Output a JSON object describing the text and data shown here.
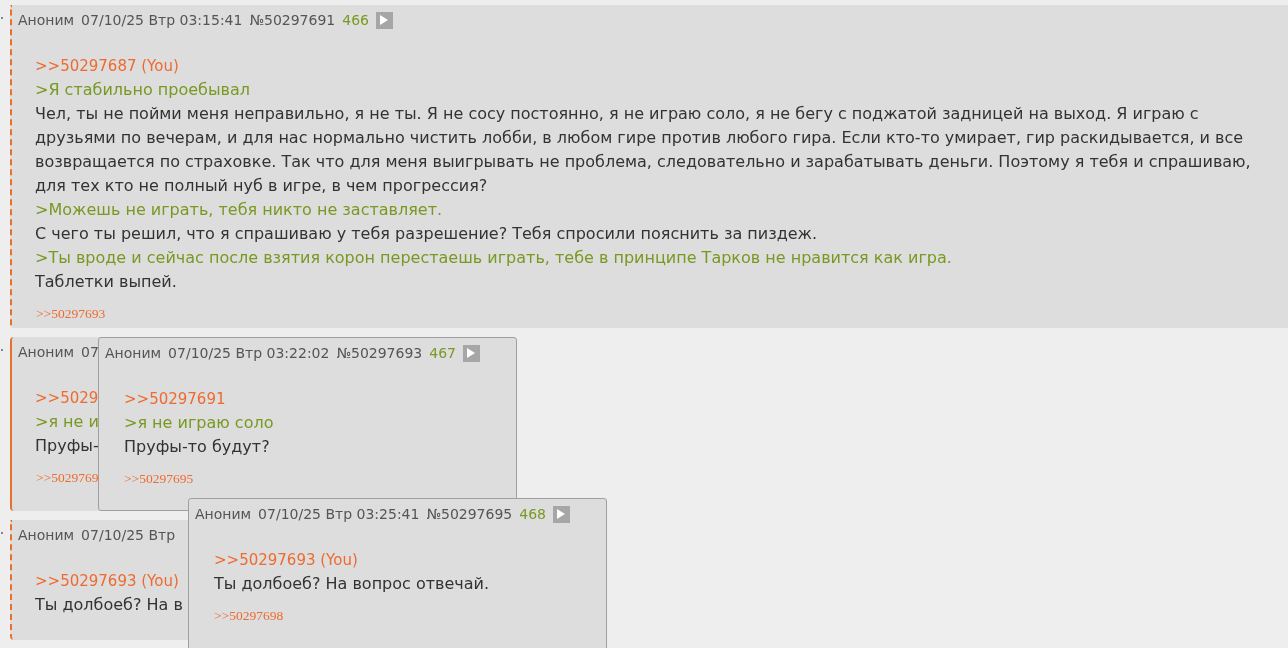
{
  "posts": [
    {
      "kind": "dashed",
      "author": "Аноним",
      "date": "07/10/25 Втр 03:15:41",
      "number": "№50297691",
      "index": "466",
      "play_button": true,
      "lines": [
        {
          "kind": "link",
          "text": ">>50297687 (You)"
        },
        {
          "kind": "quote",
          "text": ">Я стабильно проебывал"
        },
        {
          "kind": "text",
          "text": "Чел, ты не пойми меня неправильно, я не ты. Я не сосу постоянно, я не играю соло, я не бегу с поджатой задницей на выход. Я играю с друзьями по вечерам, и для нас нормально чистить лобби, в любом гире против любого гира. Если кто-то умирает, гир раскидывается, и все возвращается по страховке. Так что для меня выигрывать не проблема, следовательно и зарабатывать деньги. Поэтому я тебя и спрашиваю, для тех кто не полный нуб в игре, в чем прогрессия?"
        },
        {
          "kind": "quote",
          "text": ">Можешь не играть, тебя никто не заставляет."
        },
        {
          "kind": "text",
          "text": "С чего ты решил, что я спрашиваю у тебя разрешение? Тебя спросили пояснить за пиздеж."
        },
        {
          "kind": "quote",
          "text": ">Ты вроде и сейчас после взятия корон перестаешь играть, тебе в принципе Тарков не нравится как игра."
        },
        {
          "kind": "text",
          "text": "Таблетки выпей."
        }
      ],
      "replies": [
        ">>50297693"
      ]
    },
    {
      "kind": "solid",
      "author": "Аноним",
      "date": "07",
      "lines": [
        {
          "kind": "link",
          "text": ">>5029"
        },
        {
          "kind": "quote",
          "text": ">я не и"
        },
        {
          "kind": "text",
          "text": "Пруфы-"
        }
      ],
      "replies": [
        ">>5029769"
      ]
    },
    {
      "kind": "dashed",
      "author": "Аноним",
      "date": "07/10/25 Втр",
      "lines": [
        {
          "kind": "link",
          "text": ">>50297693 (You)"
        },
        {
          "kind": "text",
          "text": "Ты долбоеб? На в"
        }
      ]
    }
  ],
  "popups": [
    {
      "author": "Аноним",
      "date": "07/10/25 Втр 03:22:02",
      "number": "№50297693",
      "index": "467",
      "play_button": true,
      "lines": [
        {
          "kind": "link",
          "text": ">>50297691"
        },
        {
          "kind": "quote",
          "text": ">я не играю соло"
        },
        {
          "kind": "text",
          "text": "Пруфы-то будут?"
        }
      ],
      "replies": [
        ">>50297695"
      ]
    },
    {
      "author": "Аноним",
      "date": "07/10/25 Втр 03:25:41",
      "number": "№50297695",
      "index": "468",
      "play_button": true,
      "lines": [
        {
          "kind": "link",
          "text": ">>50297693 (You)"
        },
        {
          "kind": "text",
          "text": "Ты долбоеб? На вопрос отвечай."
        }
      ],
      "replies": [
        ">>50297698"
      ]
    }
  ]
}
